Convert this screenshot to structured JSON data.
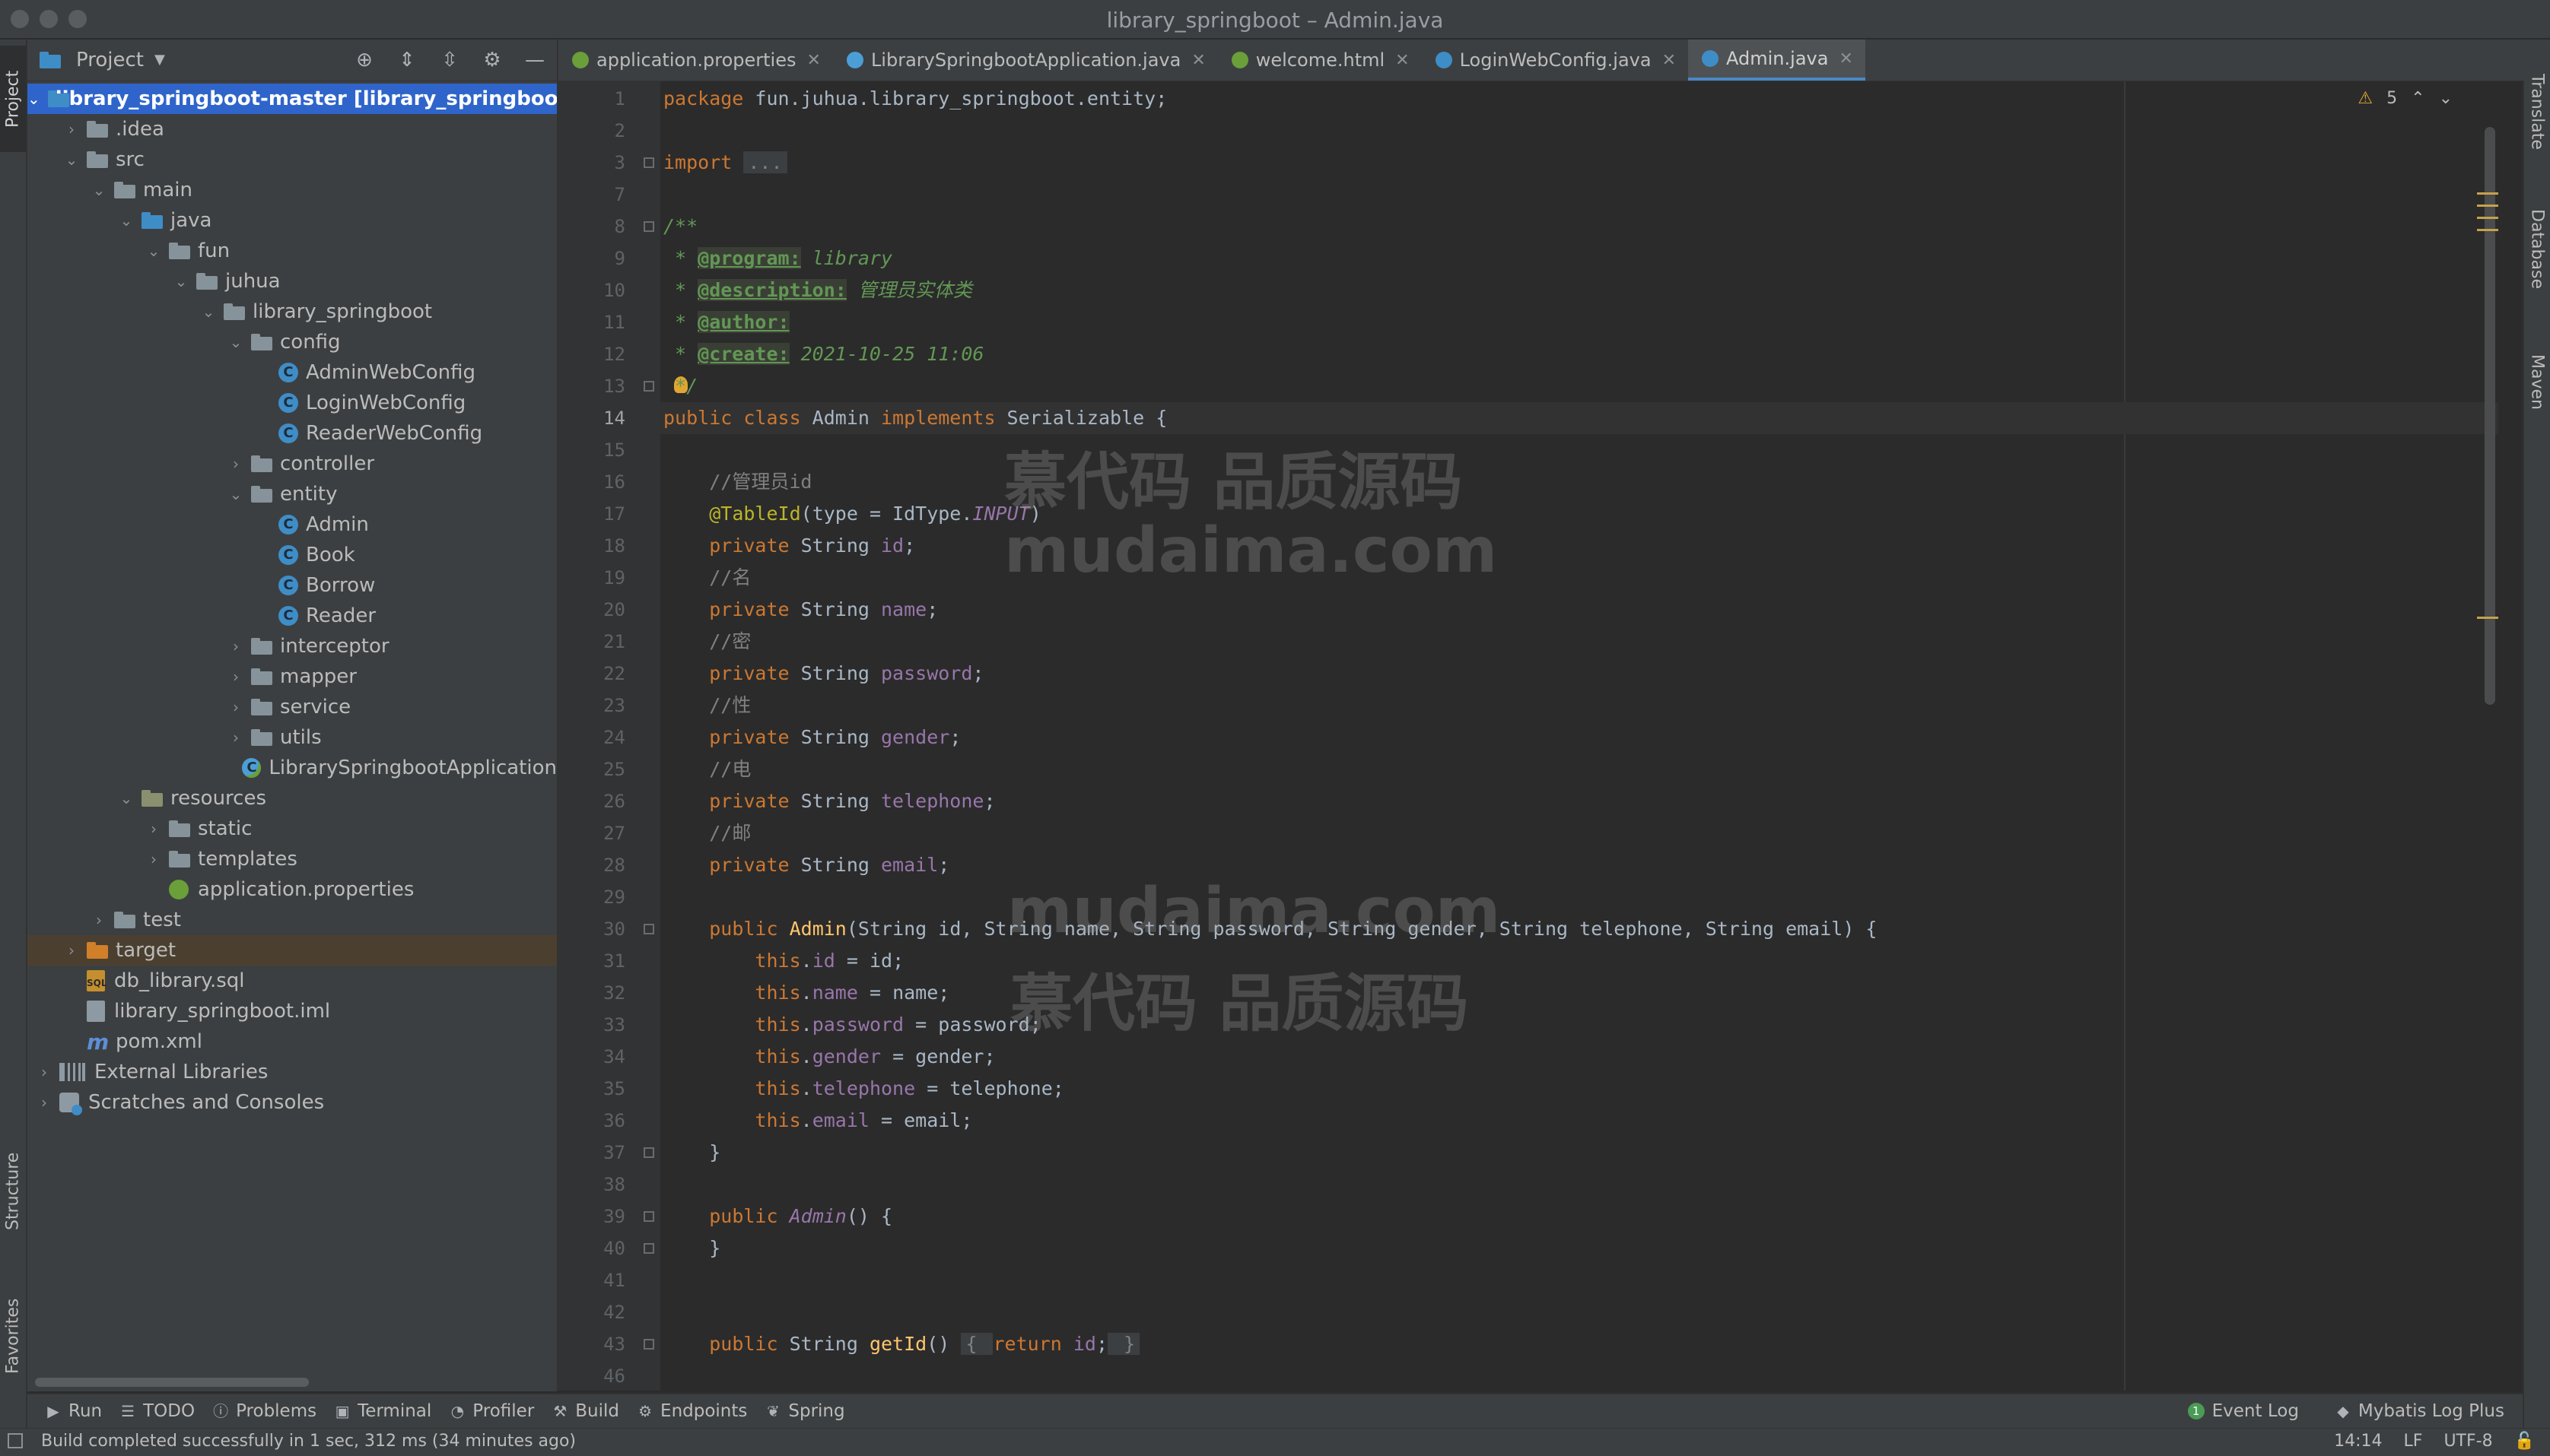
{
  "window": {
    "title": "library_springboot – Admin.java"
  },
  "left_strip": {
    "project": "Project",
    "structure": "Structure",
    "favorites": "Favorites"
  },
  "right_strip": {
    "translate": "Translate",
    "database": "Database",
    "maven": "Maven"
  },
  "project_panel": {
    "title": "Project",
    "tree": [
      {
        "label": "library_springboot-master [library_springboot]",
        "suffix": " ·",
        "depth": 0,
        "type": "module",
        "open": true,
        "selected": true
      },
      {
        "label": ".idea",
        "depth": 1,
        "type": "folder",
        "open": false
      },
      {
        "label": "src",
        "depth": 1,
        "type": "folder",
        "open": true
      },
      {
        "label": "main",
        "depth": 2,
        "type": "folder",
        "open": true
      },
      {
        "label": "java",
        "depth": 3,
        "type": "folder-blue",
        "open": true
      },
      {
        "label": "fun",
        "depth": 4,
        "type": "folder",
        "open": true
      },
      {
        "label": "juhua",
        "depth": 5,
        "type": "folder",
        "open": true
      },
      {
        "label": "library_springboot",
        "depth": 6,
        "type": "folder",
        "open": true
      },
      {
        "label": "config",
        "depth": 7,
        "type": "folder",
        "open": true
      },
      {
        "label": "AdminWebConfig",
        "depth": 8,
        "type": "class"
      },
      {
        "label": "LoginWebConfig",
        "depth": 8,
        "type": "class"
      },
      {
        "label": "ReaderWebConfig",
        "depth": 8,
        "type": "class"
      },
      {
        "label": "controller",
        "depth": 7,
        "type": "folder",
        "open": false
      },
      {
        "label": "entity",
        "depth": 7,
        "type": "folder",
        "open": true
      },
      {
        "label": "Admin",
        "depth": 8,
        "type": "class"
      },
      {
        "label": "Book",
        "depth": 8,
        "type": "class"
      },
      {
        "label": "Borrow",
        "depth": 8,
        "type": "class"
      },
      {
        "label": "Reader",
        "depth": 8,
        "type": "class"
      },
      {
        "label": "interceptor",
        "depth": 7,
        "type": "folder",
        "open": false
      },
      {
        "label": "mapper",
        "depth": 7,
        "type": "folder",
        "open": false
      },
      {
        "label": "service",
        "depth": 7,
        "type": "folder",
        "open": false
      },
      {
        "label": "utils",
        "depth": 7,
        "type": "folder",
        "open": false
      },
      {
        "label": "LibrarySpringbootApplication",
        "depth": 7,
        "type": "spring-class"
      },
      {
        "label": "resources",
        "depth": 3,
        "type": "folder-res",
        "open": true
      },
      {
        "label": "static",
        "depth": 4,
        "type": "folder",
        "open": false
      },
      {
        "label": "templates",
        "depth": 4,
        "type": "folder",
        "open": false
      },
      {
        "label": "application.properties",
        "depth": 4,
        "type": "properties"
      },
      {
        "label": "test",
        "depth": 2,
        "type": "folder",
        "open": false
      },
      {
        "label": "target",
        "depth": 1,
        "type": "folder-orange",
        "open": false,
        "highlight": true
      },
      {
        "label": "db_library.sql",
        "depth": 1,
        "type": "sql"
      },
      {
        "label": "library_springboot.iml",
        "depth": 1,
        "type": "file"
      },
      {
        "label": "pom.xml",
        "depth": 1,
        "type": "maven"
      },
      {
        "label": "External Libraries",
        "depth": 0,
        "type": "libraries",
        "open": false
      },
      {
        "label": "Scratches and Consoles",
        "depth": 0,
        "type": "scratches",
        "open": false
      }
    ]
  },
  "tabs": [
    {
      "label": "application.properties",
      "icon_color": "#6a9f3a",
      "active": false
    },
    {
      "label": "LibrarySpringbootApplication.java",
      "icon_color": "#4b9fd6",
      "active": false
    },
    {
      "label": "welcome.html",
      "icon_color": "#6a9f3a",
      "active": false
    },
    {
      "label": "LoginWebConfig.java",
      "icon_color": "#3f8dc7",
      "active": false
    },
    {
      "label": "Admin.java",
      "icon_color": "#3f8dc7",
      "active": true
    }
  ],
  "editor": {
    "warning_count": "5",
    "current_line": "14",
    "watermarks": [
      "慕代码 品质源码",
      "mudaima.com",
      "mudaima.com",
      "慕代码 品质源码"
    ],
    "lines": [
      {
        "n": "1",
        "html": "<span class=\"kw\">package</span> fun.juhua.library_springboot.entity;"
      },
      {
        "n": "2",
        "html": ""
      },
      {
        "n": "3",
        "html": "<span class=\"kw\">import</span> <span class=\"fold-box\">...</span>"
      },
      {
        "n": "7",
        "html": ""
      },
      {
        "n": "8",
        "html": "<span class=\"doc\">/**</span>"
      },
      {
        "n": "9",
        "html": "<span class=\"doc\"> * </span><span class=\"tag\">@program:</span><span class=\"doc\"> library</span>"
      },
      {
        "n": "10",
        "html": "<span class=\"doc\"> * </span><span class=\"tag\">@description:</span><span class=\"doc\"> 管理员实体类</span>"
      },
      {
        "n": "11",
        "html": "<span class=\"doc\"> * </span><span class=\"tag\">@author:</span>"
      },
      {
        "n": "12",
        "html": "<span class=\"doc\"> * </span><span class=\"tag\">@create:</span><span class=\"doc\"> 2021-10-25 11:06</span>"
      },
      {
        "n": "13",
        "html": "<span class=\"doc\"> */</span>"
      },
      {
        "n": "14",
        "html": "<span class=\"kw\">public class</span> Admin <span class=\"kw\">implements</span> Serializable {"
      },
      {
        "n": "15",
        "html": ""
      },
      {
        "n": "16",
        "html": "    <span class=\"cmt\">//管理员id</span>"
      },
      {
        "n": "17",
        "html": "    <span class=\"ann\">@TableId</span>(type = IdType.<span class=\"cst\">INPUT</span>)"
      },
      {
        "n": "18",
        "html": "    <span class=\"kw\">private</span> String <span class=\"fld\">id</span>;"
      },
      {
        "n": "19",
        "html": "    <span class=\"cmt\">//名</span>"
      },
      {
        "n": "20",
        "html": "    <span class=\"kw\">private</span> String <span class=\"fld\">name</span>;"
      },
      {
        "n": "21",
        "html": "    <span class=\"cmt\">//密</span>"
      },
      {
        "n": "22",
        "html": "    <span class=\"kw\">private</span> String <span class=\"fld\">password</span>;"
      },
      {
        "n": "23",
        "html": "    <span class=\"cmt\">//性</span>"
      },
      {
        "n": "24",
        "html": "    <span class=\"kw\">private</span> String <span class=\"fld\">gender</span>;"
      },
      {
        "n": "25",
        "html": "    <span class=\"cmt\">//电</span>"
      },
      {
        "n": "26",
        "html": "    <span class=\"kw\">private</span> String <span class=\"fld\">telephone</span>;"
      },
      {
        "n": "27",
        "html": "    <span class=\"cmt\">//邮</span>"
      },
      {
        "n": "28",
        "html": "    <span class=\"kw\">private</span> String <span class=\"fld\">email</span>;"
      },
      {
        "n": "29",
        "html": ""
      },
      {
        "n": "30",
        "html": "    <span class=\"kw\">public</span> <span class=\"fn\">Admin</span>(String id, String name, String password, String gender, String telephone, String email) {"
      },
      {
        "n": "31",
        "html": "        <span class=\"kw\">this</span>.<span class=\"fld\">id</span> = id;"
      },
      {
        "n": "32",
        "html": "        <span class=\"kw\">this</span>.<span class=\"fld\">name</span> = name;"
      },
      {
        "n": "33",
        "html": "        <span class=\"kw\">this</span>.<span class=\"fld\">password</span> = password;"
      },
      {
        "n": "34",
        "html": "        <span class=\"kw\">this</span>.<span class=\"fld\">gender</span> = gender;"
      },
      {
        "n": "35",
        "html": "        <span class=\"kw\">this</span>.<span class=\"fld\">telephone</span> = telephone;"
      },
      {
        "n": "36",
        "html": "        <span class=\"kw\">this</span>.<span class=\"fld\">email</span> = email;"
      },
      {
        "n": "37",
        "html": "    }"
      },
      {
        "n": "38",
        "html": ""
      },
      {
        "n": "39",
        "html": "    <span class=\"kw\">public</span> <span class=\"cst\">Admin</span>() {"
      },
      {
        "n": "40",
        "html": "    }"
      },
      {
        "n": "41",
        "html": ""
      },
      {
        "n": "42",
        "html": ""
      },
      {
        "n": "43",
        "html": "    <span class=\"kw\">public</span> String <span class=\"fn\">getId</span>() <span class=\"fold-box\">{ </span><span class=\"kw\">return</span> <span class=\"fld\">id</span>;<span class=\"fold-box\"> }</span>"
      },
      {
        "n": "46",
        "html": ""
      }
    ]
  },
  "bottom_tools": [
    {
      "label": "Run",
      "icon": "play-icon"
    },
    {
      "label": "TODO",
      "icon": "list-icon"
    },
    {
      "label": "Problems",
      "icon": "info-icon"
    },
    {
      "label": "Terminal",
      "icon": "terminal-icon"
    },
    {
      "label": "Profiler",
      "icon": "profiler-icon"
    },
    {
      "label": "Build",
      "icon": "hammer-icon"
    },
    {
      "label": "Endpoints",
      "icon": "endpoints-icon"
    },
    {
      "label": "Spring",
      "icon": "spring-icon"
    }
  ],
  "bottom_right_tools": [
    {
      "label": "Event Log",
      "badge": "1"
    },
    {
      "label": "Mybatis Log Plus"
    }
  ],
  "status": {
    "message": "Build completed successfully in 1 sec, 312 ms (34 minutes ago)",
    "position": "14:14",
    "line_ending": "LF",
    "encoding": "UTF-8"
  }
}
